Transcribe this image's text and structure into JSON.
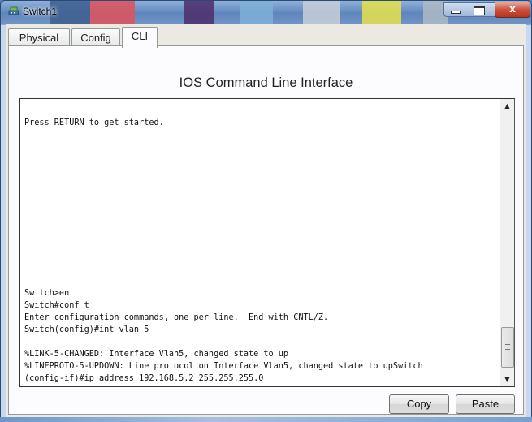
{
  "window": {
    "title": "Switch1",
    "close_glyph": "x",
    "app_icon": "switch-device-icon"
  },
  "tabs": [
    {
      "label": "Physical",
      "active": false
    },
    {
      "label": "Config",
      "active": false
    },
    {
      "label": "CLI",
      "active": true
    }
  ],
  "panel": {
    "title": "IOS Command Line Interface"
  },
  "terminal": {
    "lines": [
      "",
      "Press RETURN to get started.",
      "",
      "",
      "",
      "",
      "",
      "",
      "",
      "",
      "",
      "",
      "",
      "",
      "",
      "Switch>en",
      "Switch#conf t",
      "Enter configuration commands, one per line.  End with CNTL/Z.",
      "Switch(config)#int vlan 5",
      "",
      "%LINK-5-CHANGED: Interface Vlan5, changed state to up",
      "%LINEPROTO-5-UPDOWN: Line protocol on Interface Vlan5, changed state to upSwitch",
      "(config-if)#ip address 192.168.5.2 255.255.255.0"
    ]
  },
  "scrollbar": {
    "up_glyph": "▲",
    "down_glyph": "▼"
  },
  "buttons": {
    "copy_label": "Copy",
    "paste_label": "Paste"
  }
}
